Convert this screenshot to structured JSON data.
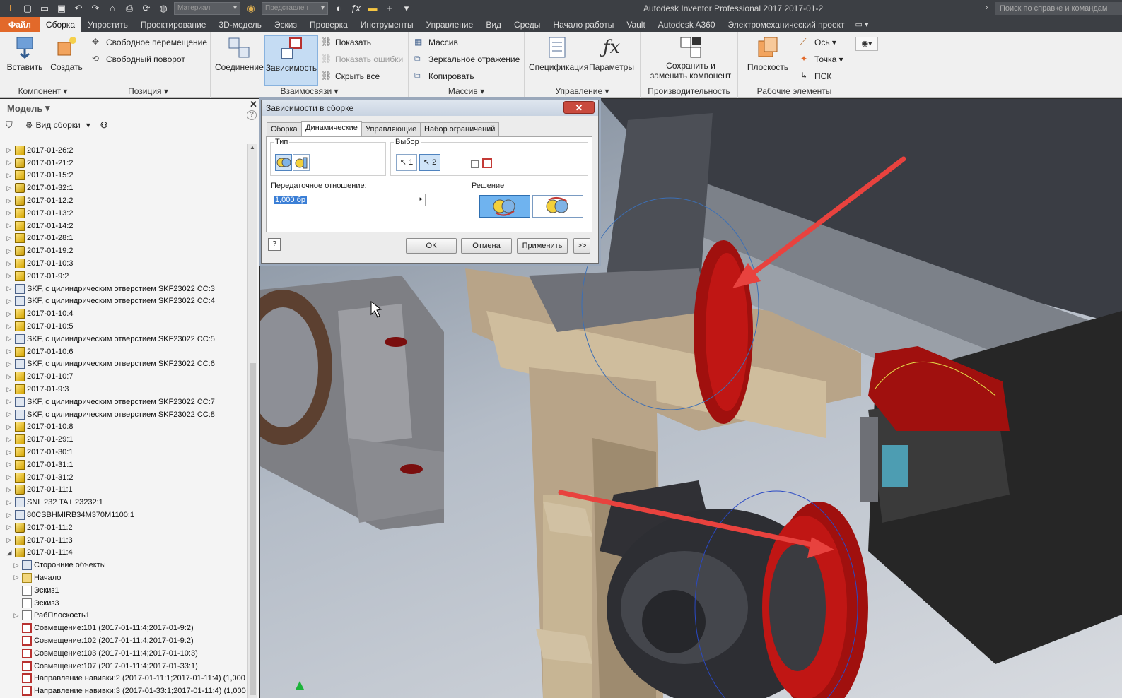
{
  "title_bar": {
    "app_title": "Autodesk Inventor Professional 2017    2017-01-2",
    "material_combo": "Материал",
    "appearance_combo": "Представлен",
    "help_search_placeholder": "Поиск по справке и командам"
  },
  "menu": {
    "tabs": [
      "Файл",
      "Сборка",
      "Упростить",
      "Проектирование",
      "3D-модель",
      "Эскиз",
      "Проверка",
      "Инструменты",
      "Управление",
      "Вид",
      "Среды",
      "Начало работы",
      "Vault",
      "Autodesk A360",
      "Электромеханический проект"
    ],
    "active_index": 1
  },
  "ribbon": {
    "component": {
      "label": "Компонент",
      "insert": "Вставить",
      "create": "Создать"
    },
    "position": {
      "label": "Позиция",
      "free_move": "Свободное перемещение",
      "free_rotate": "Свободный поворот"
    },
    "relationships": {
      "label": "Взаимосвязи",
      "joint": "Соединение",
      "constrain": "Зависимость",
      "show": "Показать",
      "show_sick": "Показать ошибки",
      "hide_all": "Скрыть все"
    },
    "pattern": {
      "label": "Массив",
      "pattern": "Массив",
      "mirror": "Зеркальное отражение",
      "copy": "Копировать"
    },
    "manage": {
      "label": "Управление",
      "bom": "Спецификация",
      "parameters": "Параметры"
    },
    "productivity": {
      "label": "Производительность",
      "save_replace": "Сохранить и\nзаменить компонент"
    },
    "work_features": {
      "label": "Рабочие элементы",
      "plane": "Плоскость",
      "axis": "Ось",
      "point": "Точка",
      "ucs": "ПСК"
    }
  },
  "browser": {
    "title": "Модель",
    "view_label": "Вид сборки",
    "items": [
      {
        "label": "2017-01-26:2",
        "icon": "part",
        "indent": 0,
        "twisty": "▷"
      },
      {
        "label": "2017-01-21:2",
        "icon": "asm",
        "indent": 0,
        "twisty": "▷"
      },
      {
        "label": "2017-01-15:2",
        "icon": "part",
        "indent": 0,
        "twisty": "▷"
      },
      {
        "label": "2017-01-32:1",
        "icon": "asm",
        "indent": 0,
        "twisty": "▷"
      },
      {
        "label": "2017-01-12:2",
        "icon": "asm",
        "indent": 0,
        "twisty": "▷"
      },
      {
        "label": "2017-01-13:2",
        "icon": "part",
        "indent": 0,
        "twisty": "▷"
      },
      {
        "label": "2017-01-14:2",
        "icon": "part",
        "indent": 0,
        "twisty": "▷"
      },
      {
        "label": "2017-01-28:1",
        "icon": "part",
        "indent": 0,
        "twisty": "▷"
      },
      {
        "label": "2017-01-19:2",
        "icon": "asm",
        "indent": 0,
        "twisty": "▷"
      },
      {
        "label": "2017-01-10:3",
        "icon": "part",
        "indent": 0,
        "twisty": "▷"
      },
      {
        "label": "2017-01-9:2",
        "icon": "part",
        "indent": 0,
        "twisty": "▷"
      },
      {
        "label": "SKF, с цилиндрическим отверстием SKF23022 CC:3",
        "icon": "sub",
        "indent": 0,
        "twisty": "▷"
      },
      {
        "label": "SKF, с цилиндрическим отверстием SKF23022 CC:4",
        "icon": "sub",
        "indent": 0,
        "twisty": "▷"
      },
      {
        "label": "2017-01-10:4",
        "icon": "part",
        "indent": 0,
        "twisty": "▷"
      },
      {
        "label": "2017-01-10:5",
        "icon": "part",
        "indent": 0,
        "twisty": "▷"
      },
      {
        "label": "SKF, с цилиндрическим отверстием SKF23022 CC:5",
        "icon": "sub",
        "indent": 0,
        "twisty": "▷"
      },
      {
        "label": "2017-01-10:6",
        "icon": "part",
        "indent": 0,
        "twisty": "▷"
      },
      {
        "label": "SKF, с цилиндрическим отверстием SKF23022 CC:6",
        "icon": "sub",
        "indent": 0,
        "twisty": "▷"
      },
      {
        "label": "2017-01-10:7",
        "icon": "part",
        "indent": 0,
        "twisty": "▷"
      },
      {
        "label": "2017-01-9:3",
        "icon": "part",
        "indent": 0,
        "twisty": "▷"
      },
      {
        "label": "SKF, с цилиндрическим отверстием SKF23022 CC:7",
        "icon": "sub",
        "indent": 0,
        "twisty": "▷"
      },
      {
        "label": "SKF, с цилиндрическим отверстием SKF23022 CC:8",
        "icon": "sub",
        "indent": 0,
        "twisty": "▷"
      },
      {
        "label": "2017-01-10:8",
        "icon": "part",
        "indent": 0,
        "twisty": "▷"
      },
      {
        "label": "2017-01-29:1",
        "icon": "part",
        "indent": 0,
        "twisty": "▷"
      },
      {
        "label": "2017-01-30:1",
        "icon": "part",
        "indent": 0,
        "twisty": "▷"
      },
      {
        "label": "2017-01-31:1",
        "icon": "part",
        "indent": 0,
        "twisty": "▷"
      },
      {
        "label": "2017-01-31:2",
        "icon": "part",
        "indent": 0,
        "twisty": "▷"
      },
      {
        "label": "2017-01-11:1",
        "icon": "asm",
        "indent": 0,
        "twisty": "▷"
      },
      {
        "label": "SNL 232 TA+ 23232:1",
        "icon": "sub",
        "indent": 0,
        "twisty": "▷"
      },
      {
        "label": "80CSBHMIRB34M370M1100:1",
        "icon": "sub",
        "indent": 0,
        "twisty": "▷"
      },
      {
        "label": "2017-01-11:2",
        "icon": "asm",
        "indent": 0,
        "twisty": "▷"
      },
      {
        "label": "2017-01-11:3",
        "icon": "asm",
        "indent": 0,
        "twisty": "▷"
      },
      {
        "label": "2017-01-11:4",
        "icon": "asm",
        "indent": 0,
        "twisty": "◢"
      },
      {
        "label": "Сторонние объекты",
        "icon": "sub",
        "indent": 1,
        "twisty": "▷"
      },
      {
        "label": "Начало",
        "icon": "folder",
        "indent": 1,
        "twisty": "▷"
      },
      {
        "label": "Эскиз1",
        "icon": "sketch",
        "indent": 1,
        "twisty": ""
      },
      {
        "label": "Эскиз3",
        "icon": "sketch",
        "indent": 1,
        "twisty": ""
      },
      {
        "label": "РабПлоскость1",
        "icon": "sketch",
        "indent": 1,
        "twisty": "▷"
      },
      {
        "label": "Совмещение:101 (2017-01-11:4;2017-01-9:2)",
        "icon": "con",
        "indent": 1,
        "twisty": ""
      },
      {
        "label": "Совмещение:102 (2017-01-11:4;2017-01-9:2)",
        "icon": "con",
        "indent": 1,
        "twisty": ""
      },
      {
        "label": "Совмещение:103 (2017-01-11:4;2017-01-10:3)",
        "icon": "con",
        "indent": 1,
        "twisty": ""
      },
      {
        "label": "Совмещение:107 (2017-01-11:4;2017-01-33:1)",
        "icon": "con",
        "indent": 1,
        "twisty": ""
      },
      {
        "label": "Направление навивки:2 (2017-01-11:1;2017-01-11:4) (1,000",
        "icon": "con",
        "indent": 1,
        "twisty": ""
      },
      {
        "label": "Направление навивки:3 (2017-01-33:1;2017-01-11:4) (1,000",
        "icon": "con",
        "indent": 1,
        "twisty": ""
      }
    ]
  },
  "dialog": {
    "title": "Зависимости в сборке",
    "close": "✕",
    "tabs": [
      "Сборка",
      "Динамические",
      "Управляющие",
      "Набор ограничений"
    ],
    "active_tab": 1,
    "type_label": "Тип",
    "selection_label": "Выбор",
    "sel1": "1",
    "sel2": "2",
    "ratio_label": "Передаточное отношение:",
    "ratio_value": "1,000 бр",
    "solution_label": "Решение",
    "ok": "ОК",
    "cancel": "Отмена",
    "apply": "Применить",
    "more": ">>"
  },
  "colors": {
    "accent": "#e2692a",
    "title_bg": "#3c3f44",
    "ribbon_bg": "#f0f0f0",
    "part_red": "#b0110f",
    "arrow_red": "#e8423e"
  },
  "icons": [
    "home-icon",
    "undo-icon",
    "redo-icon",
    "filter-icon",
    "binoculars-icon",
    "help-icon"
  ]
}
